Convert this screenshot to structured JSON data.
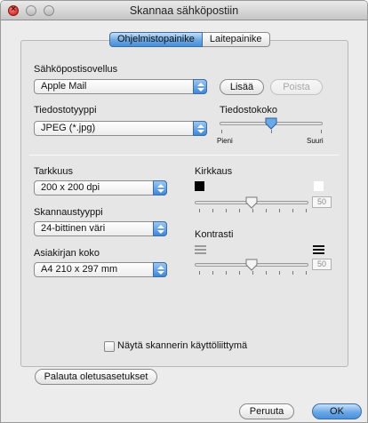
{
  "window": {
    "title": "Skannaa sähköpostiin"
  },
  "tabs": [
    {
      "label": "Ohjelmistopainike",
      "active": true
    },
    {
      "label": "Laitepainike",
      "active": false
    }
  ],
  "email_app": {
    "label": "Sähköpostisovellus",
    "selected": "Apple Mail",
    "add_label": "Lisää",
    "remove_label": "Poista"
  },
  "file_type": {
    "label": "Tiedostotyyppi",
    "selected": "JPEG (*.jpg)"
  },
  "file_size": {
    "label": "Tiedostokoko",
    "min_label": "Pieni",
    "max_label": "Suuri",
    "level": 0.5
  },
  "resolution": {
    "label": "Tarkkuus",
    "selected": "200 x 200 dpi"
  },
  "scan_type": {
    "label": "Skannaustyyppi",
    "selected": "24-bittinen väri"
  },
  "doc_size": {
    "label": "Asiakirjan koko",
    "selected": "A4  210 x 297 mm"
  },
  "brightness": {
    "label": "Kirkkaus",
    "value": "50",
    "level": 0.5
  },
  "contrast": {
    "label": "Kontrasti",
    "value": "50",
    "level": 0.5
  },
  "show_scanner_ui": {
    "label": "Näytä skannerin käyttöliittymä",
    "checked": false
  },
  "footer": {
    "restore_defaults": "Palauta oletusasetukset",
    "cancel": "Peruuta",
    "ok": "OK"
  },
  "colors": {
    "accent": "#4a90db",
    "window_bg": "#ececec"
  }
}
